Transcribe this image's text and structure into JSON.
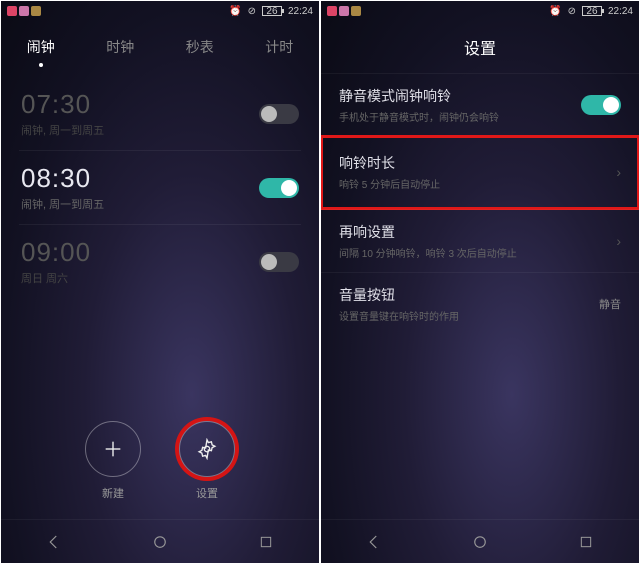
{
  "statusbar": {
    "battery": "26",
    "time": "22:24"
  },
  "left": {
    "tabs": [
      "闹钟",
      "时钟",
      "秒表",
      "计时"
    ],
    "alarms": [
      {
        "time": "07:30",
        "sub": "闹钟, 周一到周五",
        "on": false
      },
      {
        "time": "08:30",
        "sub": "闹钟, 周一到周五",
        "on": true
      },
      {
        "time": "09:00",
        "sub": "周日 周六",
        "on": false
      }
    ],
    "actions": {
      "new": "新建",
      "settings": "设置"
    }
  },
  "right": {
    "header": "设置",
    "rows": [
      {
        "title": "静音模式闹钟响铃",
        "desc": "手机处于静音模式时，闹钟仍会响铃",
        "toggle": true
      },
      {
        "title": "响铃时长",
        "desc": "响铃 5 分钟后自动停止",
        "arrow": true,
        "highlight": true
      },
      {
        "title": "再响设置",
        "desc": "间隔 10 分钟响铃，响铃 3 次后自动停止",
        "arrow": true
      },
      {
        "title": "音量按钮",
        "desc": "设置音量键在响铃时的作用",
        "value": "静音"
      }
    ]
  }
}
